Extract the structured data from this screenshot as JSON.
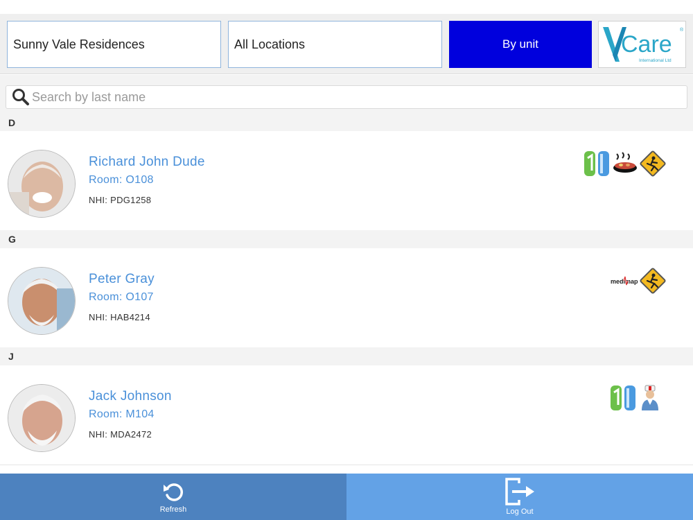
{
  "header": {
    "facility": "Sunny Vale Residences",
    "location": "All Locations",
    "view_button": "By unit",
    "logo": {
      "brand": "Vcare",
      "subtitle": "International Ltd",
      "accent": "#2aa6c8"
    }
  },
  "search": {
    "placeholder": "Search by last name",
    "value": ""
  },
  "residents": [
    {
      "section": "D",
      "name": "Richard John Dude",
      "room": "Room: O108",
      "nhi": "NHI: PDG1258",
      "icons": [
        "green-blue-bars-icon",
        "meal-bowl-icon",
        "fall-risk-warning-icon"
      ]
    },
    {
      "section": "G",
      "name": "Peter Gray",
      "room": "Room: O107",
      "nhi": "NHI: HAB4214",
      "icons": [
        "medimap-icon",
        "fall-risk-warning-icon"
      ],
      "icon_text": "medimap"
    },
    {
      "section": "J",
      "name": "Jack Johnson",
      "room": "Room: M104",
      "nhi": "NHI: MDA2472",
      "icons": [
        "green-blue-bars-icon",
        "nurse-icon"
      ]
    }
  ],
  "footer": {
    "refresh": "Refresh",
    "logout": "Log Out"
  },
  "colors": {
    "unit_button": "#0000dd",
    "name_text": "#4a90d9",
    "refresh_bg": "#4d82bf",
    "logout_bg": "#63a2e6"
  }
}
